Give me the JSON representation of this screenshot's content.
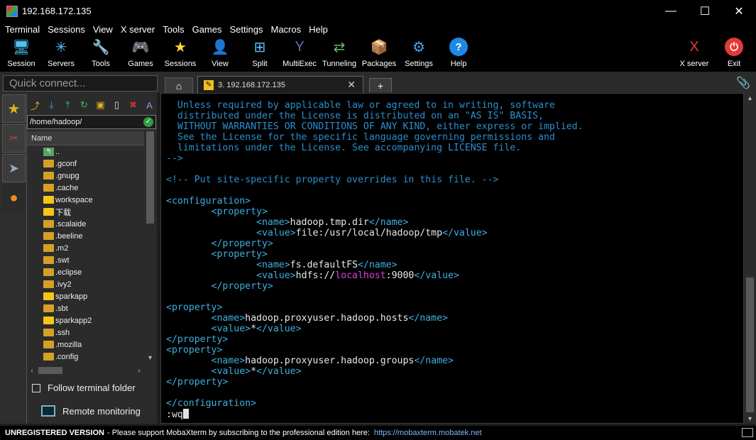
{
  "window": {
    "title": "192.168.172.135",
    "minimize": "—",
    "maximize": "☐",
    "close": "✕"
  },
  "menu": [
    "Terminal",
    "Sessions",
    "View",
    "X server",
    "Tools",
    "Games",
    "Settings",
    "Macros",
    "Help"
  ],
  "toolbar": [
    {
      "label": "Session",
      "icon": "🖥"
    },
    {
      "label": "Servers",
      "icon": "✳"
    },
    {
      "label": "Tools",
      "icon": "🔧"
    },
    {
      "label": "Games",
      "icon": "🎮"
    },
    {
      "label": "Sessions",
      "icon": "★"
    },
    {
      "label": "View",
      "icon": "👤"
    },
    {
      "label": "Split",
      "icon": "⊞"
    },
    {
      "label": "MultiExec",
      "icon": "Y"
    },
    {
      "label": "Tunneling",
      "icon": "⇄"
    },
    {
      "label": "Packages",
      "icon": "📦"
    },
    {
      "label": "Settings",
      "icon": "⚙"
    },
    {
      "label": "Help",
      "icon": "?"
    }
  ],
  "toolbar_right": [
    {
      "label": "X server",
      "icon": "X"
    },
    {
      "label": "Exit",
      "icon": "⏻"
    }
  ],
  "quick_connect": {
    "placeholder": "Quick connect..."
  },
  "tabs": {
    "home_icon": "⌂",
    "session_label": "3. 192.168.172.135",
    "session_icon": "✎",
    "close": "✕",
    "new_tab": "+",
    "attach_icon": "📎"
  },
  "sidebar": {
    "path": "/home/hadoop/",
    "column_header": "Name",
    "files": [
      {
        "name": "..",
        "kind": "up"
      },
      {
        "name": ".gconf",
        "kind": "folder"
      },
      {
        "name": ".gnupg",
        "kind": "folder"
      },
      {
        "name": ".cache",
        "kind": "folder"
      },
      {
        "name": "workspace",
        "kind": "folder-bright"
      },
      {
        "name": "下载",
        "kind": "folder-bright"
      },
      {
        "name": ".scalaide",
        "kind": "folder"
      },
      {
        "name": ".beeline",
        "kind": "folder"
      },
      {
        "name": ".m2",
        "kind": "folder"
      },
      {
        "name": ".swt",
        "kind": "folder"
      },
      {
        "name": ".eclipse",
        "kind": "folder"
      },
      {
        "name": ".ivy2",
        "kind": "folder"
      },
      {
        "name": "sparkapp",
        "kind": "folder-bright"
      },
      {
        "name": ".sbt",
        "kind": "folder"
      },
      {
        "name": "sparkapp2",
        "kind": "folder-bright"
      },
      {
        "name": ".ssh",
        "kind": "folder"
      },
      {
        "name": ".mozilla",
        "kind": "folder"
      },
      {
        "name": ".config",
        "kind": "folder"
      }
    ],
    "follow_label": "Follow terminal folder",
    "monitor_label": "Remote monitoring"
  },
  "terminal": {
    "lines": [
      [
        {
          "c": "comment",
          "t": "  Unless required by applicable law or agreed to in writing, software"
        }
      ],
      [
        {
          "c": "comment",
          "t": "  distributed under the License is distributed on an \"AS IS\" BASIS,"
        }
      ],
      [
        {
          "c": "comment",
          "t": "  WITHOUT WARRANTIES OR CONDITIONS OF ANY KIND, either express or implied."
        }
      ],
      [
        {
          "c": "comment",
          "t": "  See the License for the specific language governing permissions and"
        }
      ],
      [
        {
          "c": "comment",
          "t": "  limitations under the License. See accompanying LICENSE file."
        }
      ],
      [
        {
          "c": "comment",
          "t": "-->"
        }
      ],
      [
        {
          "c": "text",
          "t": ""
        }
      ],
      [
        {
          "c": "comment",
          "t": "<!-- Put site-specific property overrides in this file. -->"
        }
      ],
      [
        {
          "c": "text",
          "t": ""
        }
      ],
      [
        {
          "c": "tag",
          "t": "<configuration>"
        }
      ],
      [
        {
          "c": "tag",
          "t": "        <property>"
        }
      ],
      [
        {
          "c": "tag",
          "t": "                <name>"
        },
        {
          "c": "text",
          "t": "hadoop.tmp.dir"
        },
        {
          "c": "tag",
          "t": "</name>"
        }
      ],
      [
        {
          "c": "tag",
          "t": "                <value>"
        },
        {
          "c": "text",
          "t": "file:/usr/local/hadoop/tmp"
        },
        {
          "c": "tag",
          "t": "</value>"
        }
      ],
      [
        {
          "c": "tag",
          "t": "        </property>"
        }
      ],
      [
        {
          "c": "tag",
          "t": "        <property>"
        }
      ],
      [
        {
          "c": "tag",
          "t": "                <name>"
        },
        {
          "c": "text",
          "t": "fs.defaultFS"
        },
        {
          "c": "tag",
          "t": "</name>"
        }
      ],
      [
        {
          "c": "tag",
          "t": "                <value>"
        },
        {
          "c": "text",
          "t": "hdfs://"
        },
        {
          "c": "pink",
          "t": "localhost"
        },
        {
          "c": "text",
          "t": ":9000"
        },
        {
          "c": "tag",
          "t": "</value>"
        }
      ],
      [
        {
          "c": "tag",
          "t": "        </property>"
        }
      ],
      [
        {
          "c": "text",
          "t": ""
        }
      ],
      [
        {
          "c": "tag",
          "t": "<property>"
        }
      ],
      [
        {
          "c": "tag",
          "t": "        <name>"
        },
        {
          "c": "text",
          "t": "hadoop.proxyuser.hadoop.hosts"
        },
        {
          "c": "tag",
          "t": "</name>"
        }
      ],
      [
        {
          "c": "tag",
          "t": "        <value>"
        },
        {
          "c": "text",
          "t": "*"
        },
        {
          "c": "tag",
          "t": "</value>"
        }
      ],
      [
        {
          "c": "tag",
          "t": "</property>"
        }
      ],
      [
        {
          "c": "tag",
          "t": "<property>"
        }
      ],
      [
        {
          "c": "tag",
          "t": "        <name>"
        },
        {
          "c": "text",
          "t": "hadoop.proxyuser.hadoop.groups"
        },
        {
          "c": "tag",
          "t": "</name>"
        }
      ],
      [
        {
          "c": "tag",
          "t": "        <value>"
        },
        {
          "c": "text",
          "t": "*"
        },
        {
          "c": "tag",
          "t": "</value>"
        }
      ],
      [
        {
          "c": "tag",
          "t": "</property>"
        }
      ],
      [
        {
          "c": "text",
          "t": ""
        }
      ],
      [
        {
          "c": "tag",
          "t": "</configuration>"
        }
      ]
    ],
    "command": ":wq"
  },
  "status": {
    "strong": "UNREGISTERED VERSION",
    "message": " -  Please support MobaXterm by subscribing to the professional edition here:",
    "link": "https://mobaxterm.mobatek.net"
  },
  "colors": {
    "comment": "#2a8fd0",
    "tag": "#3fb0e0",
    "highlight": "#e040e0"
  }
}
